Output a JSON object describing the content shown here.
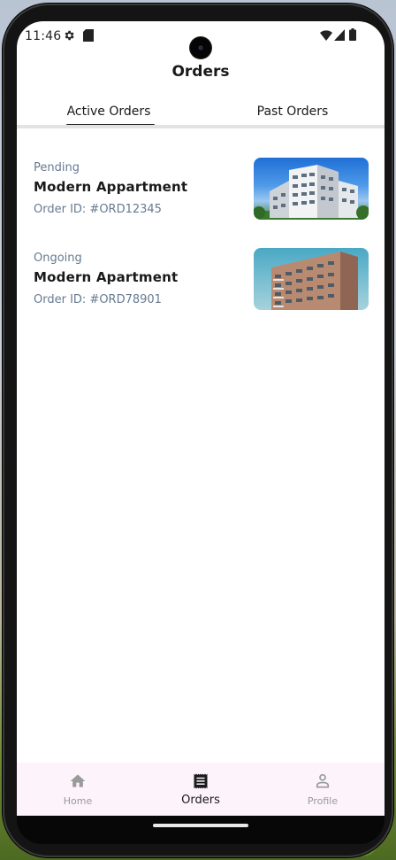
{
  "status_bar": {
    "time": "11:46"
  },
  "header": {
    "title": "Orders"
  },
  "tabs": [
    {
      "label": "Active Orders",
      "selected": true
    },
    {
      "label": "Past Orders",
      "selected": false
    }
  ],
  "orders": [
    {
      "status": "Pending",
      "name": "Modern Appartment",
      "order_id": "Order ID: #ORD12345"
    },
    {
      "status": "Ongoing",
      "name": "Modern Apartment",
      "order_id": "Order ID: #ORD78901"
    }
  ],
  "bottom_nav": {
    "items": [
      {
        "label": "Home",
        "icon": "home-icon",
        "selected": false
      },
      {
        "label": "Orders",
        "icon": "receipt-icon",
        "selected": true
      },
      {
        "label": "Profile",
        "icon": "person-icon",
        "selected": false
      }
    ]
  },
  "colors": {
    "secondary_text": "#677a91",
    "nav_background": "#fcf3fb",
    "tab_indicator": "#1f1f1f"
  }
}
